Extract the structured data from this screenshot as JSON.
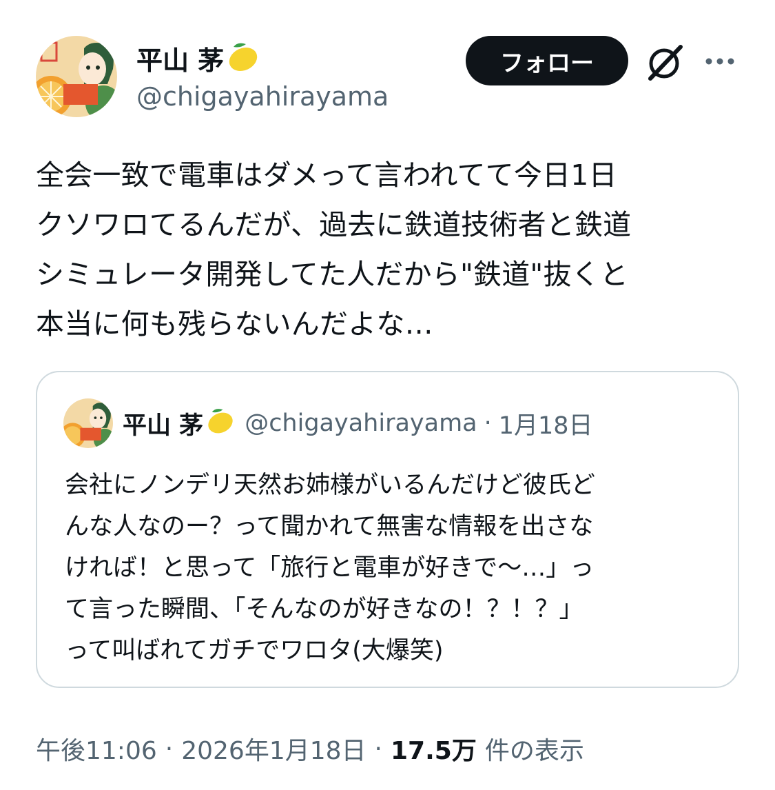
{
  "author": {
    "name": "平山 茅",
    "handle": "@chigayahirayama",
    "badge_emoji": "lemon-emoji"
  },
  "actions": {
    "follow_label": "フォロー",
    "grok_icon": "grok-icon",
    "more_icon": "more-icon"
  },
  "tweet": {
    "text": "全会一致で電車はダメって言われてて今日1日\nクソワロてるんだが、過去に鉄道技術者と鉄道\nシミュレータ開発してた人だから\"鉄道\"抜くと\n本当に何も残らないんだよな…"
  },
  "quote": {
    "name": "平山 茅",
    "handle": "@chigayahirayama",
    "separator": "·",
    "date": "1月18日",
    "text": "会社にノンデリ天然お姉様がいるんだけど彼氏ど\nんな人なのー？って聞かれて無害な情報を出さな\nければ！と思って「旅行と電車が好きで〜…」っ\nて言った瞬間、「そんなのが好きなの！？！？」\nって叫ばれてガチでワロタ(大爆笑)"
  },
  "meta": {
    "time": "午後11:06",
    "separator": "·",
    "date": "2026年1月18日",
    "views_count": "17.5万",
    "views_label": "件の表示"
  }
}
